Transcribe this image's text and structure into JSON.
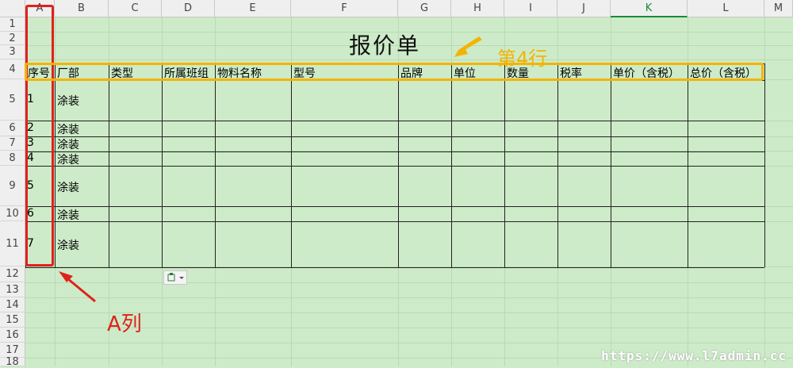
{
  "columns": [
    "A",
    "B",
    "C",
    "D",
    "E",
    "F",
    "G",
    "H",
    "I",
    "J",
    "K",
    "L",
    "M"
  ],
  "active_column": "K",
  "rows": [
    "1",
    "2",
    "3",
    "4",
    "5",
    "6",
    "7",
    "8",
    "9",
    "10",
    "11",
    "12",
    "13",
    "14",
    "15",
    "16",
    "17",
    "18"
  ],
  "title": "报价单",
  "headers": [
    "序号",
    "厂部",
    "类型",
    "所属班组",
    "物料名称",
    "型号",
    "品牌",
    "单位",
    "数量",
    "税率",
    "单价（含税）",
    "总价（含税）"
  ],
  "data_rows": [
    {
      "seq": "1",
      "dept": "涂装"
    },
    {
      "seq": "2",
      "dept": "涂装"
    },
    {
      "seq": "3",
      "dept": "涂装"
    },
    {
      "seq": "4",
      "dept": "涂装"
    },
    {
      "seq": "5",
      "dept": "涂装"
    },
    {
      "seq": "6",
      "dept": "涂装"
    },
    {
      "seq": "7",
      "dept": "涂装"
    }
  ],
  "annotations": {
    "row_label": "第4行",
    "col_label": "A列"
  },
  "watermark": "https://www.l7admin.cc",
  "colors": {
    "sheet_bg": "#cdebc8",
    "red": "#e0211c",
    "orange": "#f5b301",
    "header_bg": "#efefef"
  }
}
